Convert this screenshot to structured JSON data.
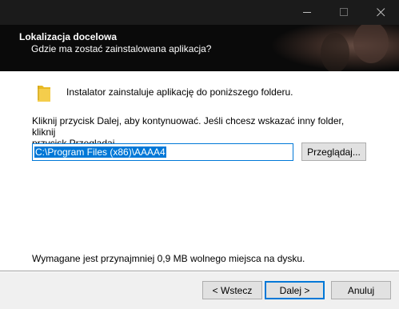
{
  "window": {
    "controls": {
      "minimize_icon": "minimize-icon",
      "maximize_icon": "maximize-icon",
      "close_icon": "close-icon"
    }
  },
  "header": {
    "title": "Lokalizacja docelowa",
    "subtitle": "Gdzie ma zostać zainstalowana aplikacja?"
  },
  "main": {
    "folder_icon": "folder-icon",
    "info": "Instalator zainstaluje aplikację do poniższego folderu.",
    "instruction_line1": "Kliknij przycisk Dalej, aby kontynuować. Jeśli chcesz wskazać inny folder, kliknij",
    "instruction_line2": "przycisk Przeglądaj.",
    "path_value": "C:\\Program Files (x86)\\AAAA4",
    "browse_label": "Przeglądaj...",
    "space_required": "Wymagane jest przynajmniej 0,9 MB wolnego miejsca na dysku."
  },
  "footer": {
    "back_label": "< Wstecz",
    "next_label": "Dalej >",
    "cancel_label": "Anuluj"
  },
  "colors": {
    "accent": "#0078d7",
    "header_bg": "#0a0a0a",
    "titlebar_bg": "#1b1b1b"
  }
}
